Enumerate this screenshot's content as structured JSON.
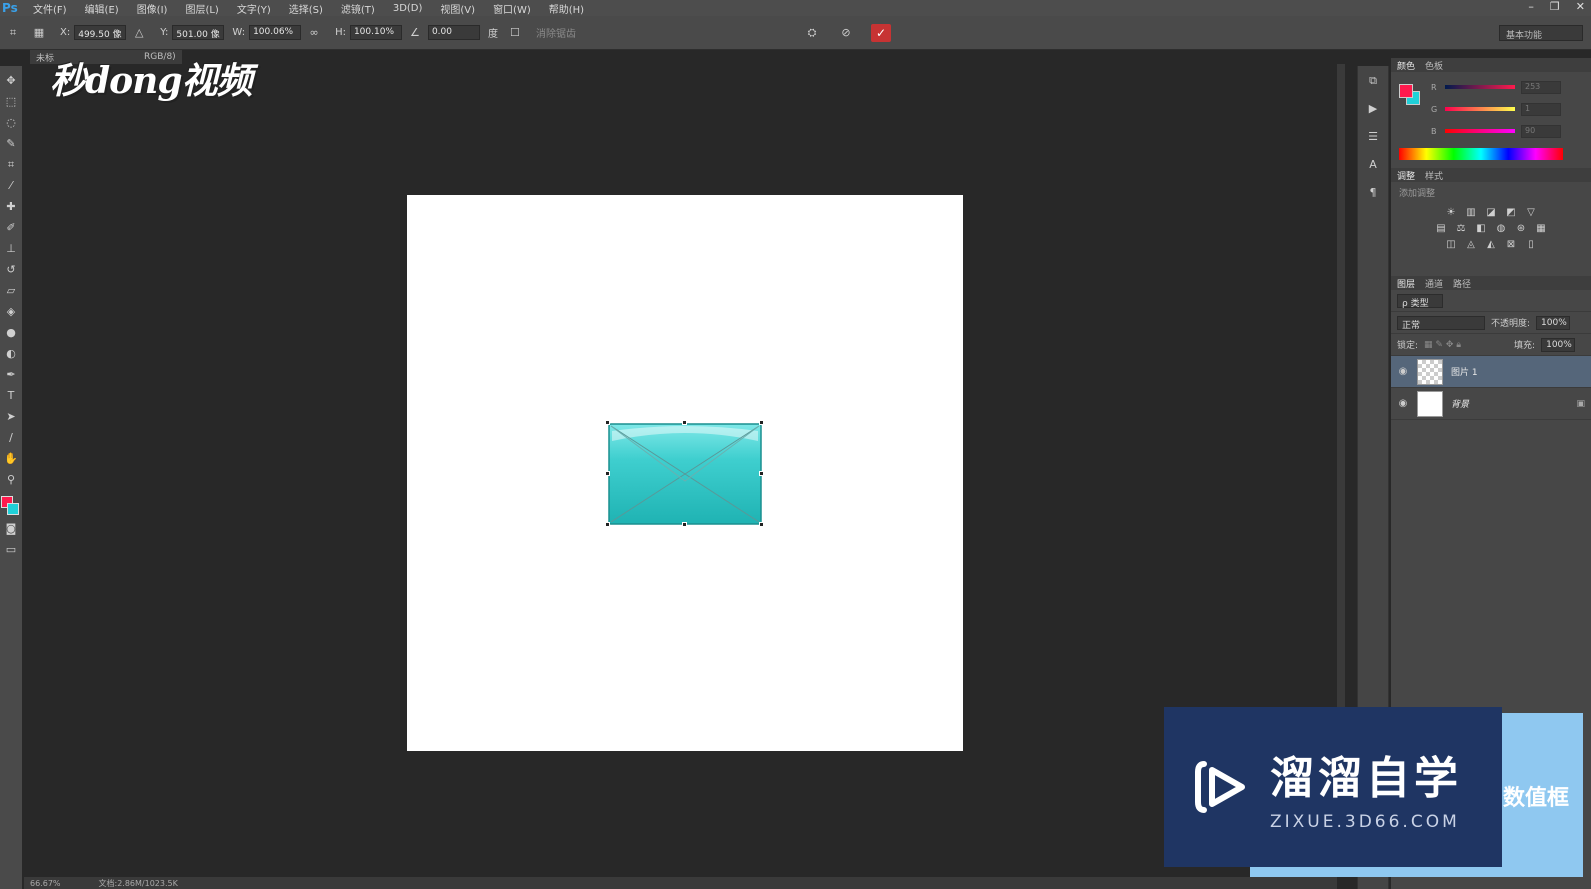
{
  "app": {
    "logo": "Ps"
  },
  "menu": [
    "文件(F)",
    "编辑(E)",
    "图像(I)",
    "图层(L)",
    "文字(Y)",
    "选择(S)",
    "滤镜(T)",
    "3D(D)",
    "视图(V)",
    "窗口(W)",
    "帮助(H)"
  ],
  "options": {
    "x_label": "X:",
    "x_value": "499.50 像",
    "y_label": "Y:",
    "y_value": "501.00 像",
    "w_label": "W:",
    "w_value": "100.06%",
    "h_label": "H:",
    "h_value": "100.10%",
    "angle_value": "0.00",
    "angle_unit": "度",
    "interp_label": "消除锯齿",
    "workspace": "基本功能"
  },
  "document": {
    "tab_title": "未标",
    "tab_mode": "RGB/8)"
  },
  "status": {
    "zoom": "66.67%",
    "doc_info": "文档:2.86M/1023.5K"
  },
  "colors": {
    "foreground": "#ff1a4d",
    "background": "#20d0d8",
    "accent_cyan": "#2fc6c6"
  },
  "color_panel": {
    "tabs": [
      "颜色",
      "色板"
    ],
    "sliders": [
      {
        "label": "R",
        "value": "253",
        "gradient": "linear-gradient(to right, #001a4d, #ff1a4d)"
      },
      {
        "label": "G",
        "value": "1",
        "gradient": "linear-gradient(to right, #fe004d, #feff4d)"
      },
      {
        "label": "B",
        "value": "90",
        "gradient": "linear-gradient(to right, #fe0100, #fe01ff)"
      }
    ]
  },
  "adjustments": {
    "tabs": [
      "调整",
      "样式"
    ],
    "title": "添加调整"
  },
  "layers": {
    "tabs": [
      "图层",
      "通道",
      "路径"
    ],
    "filter_label": "ρ 类型",
    "blend_mode": "正常",
    "opacity_label": "不透明度:",
    "opacity_value": "100%",
    "lock_label": "锁定:",
    "fill_label": "填充:",
    "fill_value": "100%",
    "items": [
      {
        "name": "图片 1",
        "selected": true
      },
      {
        "name": "背景",
        "locked": true
      }
    ]
  },
  "watermarks": {
    "logo_top": "秒dong视频",
    "zixue_cn": "溜溜自学",
    "zixue_url": "ZIXUE.3D66.COM",
    "caption": "数值框"
  }
}
